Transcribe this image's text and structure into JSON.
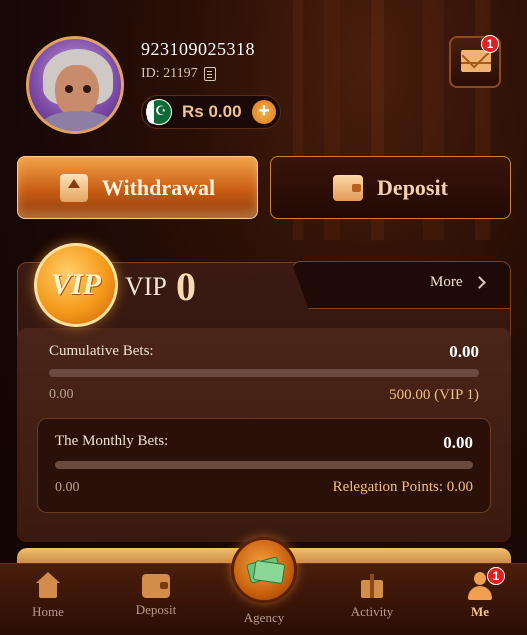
{
  "user": {
    "phone": "923109025318",
    "id_text": "ID: 21197",
    "balance": "Rs 0.00"
  },
  "mail": {
    "badge": "1"
  },
  "actions": {
    "withdrawal": "Withdrawal",
    "deposit": "Deposit"
  },
  "vip": {
    "coin_text": "VIP",
    "title": "VIP",
    "level": "0",
    "more": "More",
    "cumulative_label": "Cumulative Bets:",
    "cumulative_value": "0.00",
    "cumulative_progress": 0,
    "cumulative_min": "0.00",
    "cumulative_target": "500.00 (VIP 1)",
    "monthly_label": "The Monthly Bets:",
    "monthly_value": "0.00",
    "monthly_progress": 0,
    "monthly_min": "0.00",
    "relegation": "Relegation Points: 0.00"
  },
  "nav": {
    "home": "Home",
    "deposit": "Deposit",
    "agency": "Agency",
    "activity": "Activity",
    "me": "Me",
    "me_badge": "1"
  },
  "colors": {
    "accent": "#f0a040",
    "badge": "#e02020"
  }
}
